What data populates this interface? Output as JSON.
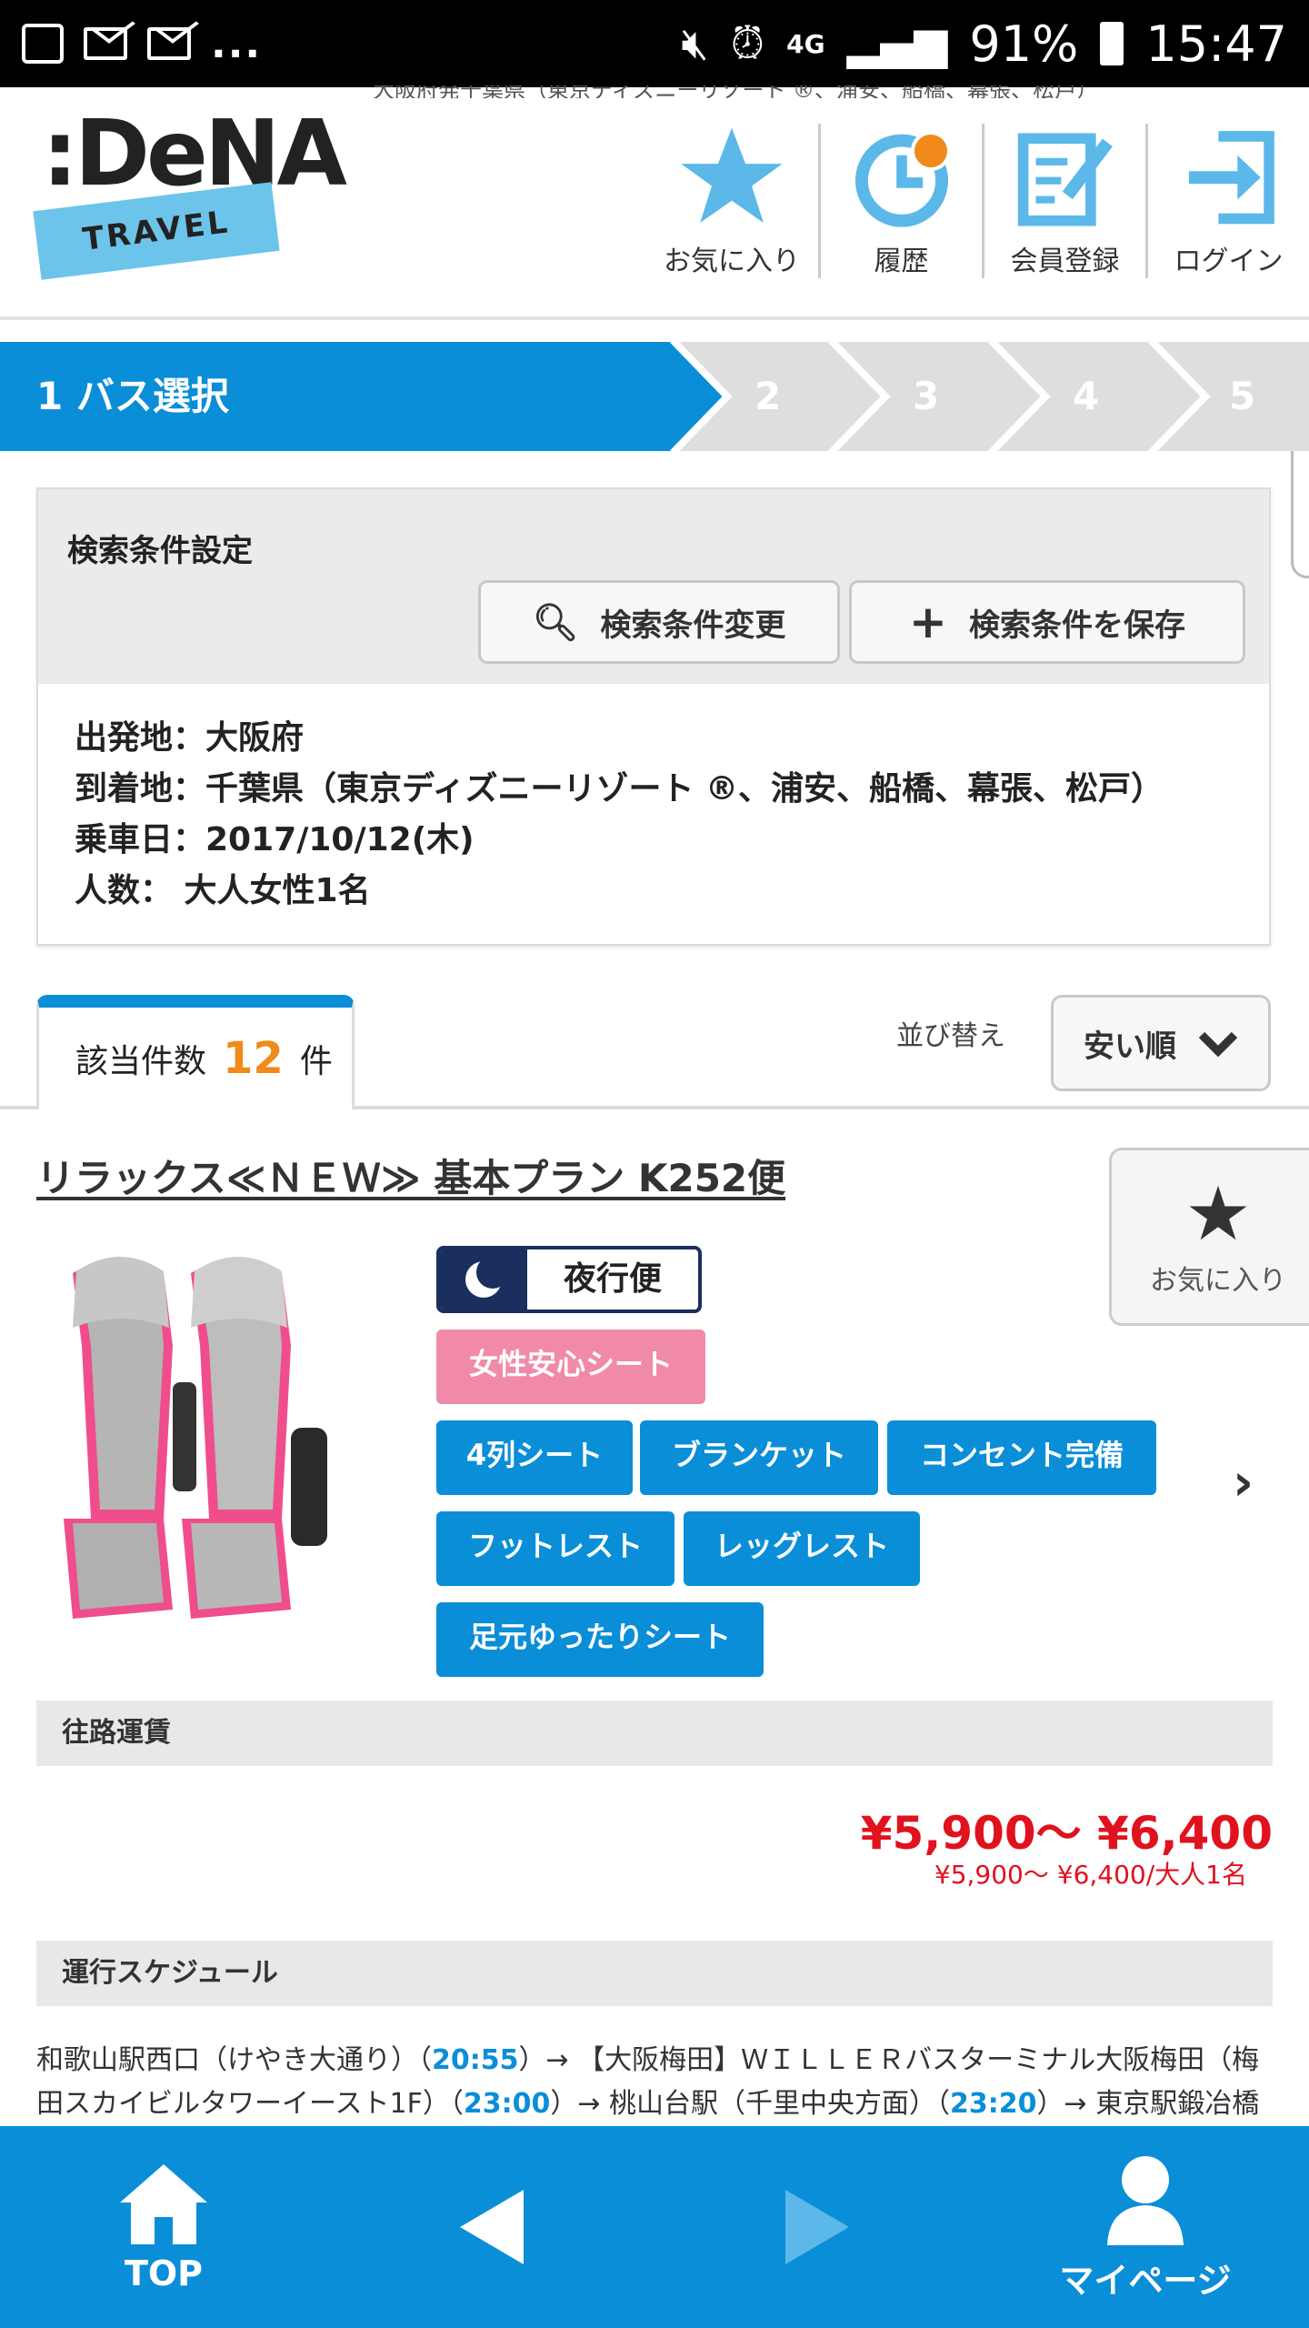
{
  "status_bar": {
    "dots": "...",
    "network": "4G",
    "battery": "91%",
    "time": "15:47"
  },
  "header": {
    "top_line": "大阪府発千葉県（東京ディズニーリゾート ®、浦安、船橋、幕張、松戸）",
    "logo_text": ":DeNA",
    "logo_sub": "TRAVEL",
    "nav": [
      {
        "label": "お気に入り",
        "icon": "star-icon"
      },
      {
        "label": "履歴",
        "icon": "clock-icon"
      },
      {
        "label": "会員登録",
        "icon": "register-icon"
      },
      {
        "label": "ログイン",
        "icon": "login-icon"
      }
    ]
  },
  "steps": {
    "active_label": "1 バス選択",
    "others": [
      "2",
      "3",
      "4",
      "5"
    ],
    "colors": {
      "active": "#0a8ed8",
      "inactive": "#dedede"
    }
  },
  "search": {
    "title": "検索条件設定",
    "change_button": "検索条件変更",
    "save_button": "検索条件を保存",
    "conditions": [
      "出発地：大阪府",
      "到着地：千葉県（東京ディズニーリゾート ®、浦安、船橋、幕張、松戸）",
      "乗車日：2017/10/12(木)",
      "人数： 大人女性1名"
    ]
  },
  "results": {
    "count_prefix": "該当件数",
    "count": "12",
    "count_suffix": "件",
    "sort_label": "並び替え",
    "sort_value": "安い順"
  },
  "plan": {
    "title": "リラックス≪ＮＥＷ≫ 基本プラン K252便",
    "favorite_label": "お気に入り",
    "night_label": "夜行便",
    "women_tag": "女性安心シート",
    "tags": [
      "4列シート",
      "ブランケット",
      "コンセント完備",
      "フットレスト",
      "レッグレスト",
      "足元ゆったりシート"
    ],
    "fare_section": "往路運賃",
    "price_main": "¥5,900〜 ¥6,400",
    "price_sub": "¥5,900〜 ¥6,400/大人1名",
    "schedule_section": "運行スケジュール",
    "schedule": {
      "s1": "和歌山駅西口（けやき大通り）（",
      "t1": "20:55",
      "s2": "）→ 【大阪梅田】ＷＩＬＬＥＲバスターミナル大阪梅田（梅田スカイビルタワーイースト1F）（",
      "t2": "23:00",
      "s3": "）→ 桃山台駅（千里中央方面）（",
      "t3": "23:20",
      "s4": "）→ 東京駅鍛冶橋"
    }
  },
  "bottom_nav": {
    "top_label": "TOP",
    "mypage_label": "マイページ"
  }
}
